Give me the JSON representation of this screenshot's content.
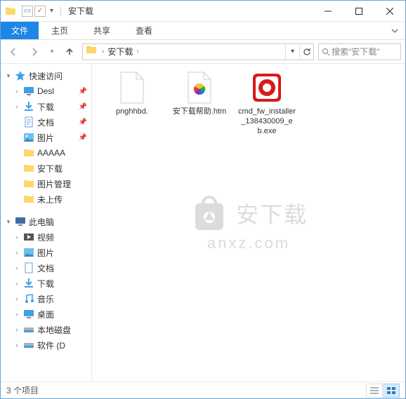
{
  "title": "安下载",
  "tabs": {
    "file": "文件",
    "home": "主页",
    "share": "共享",
    "view": "查看"
  },
  "address": {
    "crumb": "安下载"
  },
  "search": {
    "placeholder": "搜索\"安下载\""
  },
  "sidebar": {
    "quickAccess": "快速访问",
    "items": [
      {
        "label": "Desl",
        "pinned": true,
        "icon": "desktop"
      },
      {
        "label": "下载",
        "pinned": true,
        "icon": "downloads"
      },
      {
        "label": "文档",
        "pinned": true,
        "icon": "documents"
      },
      {
        "label": "图片",
        "pinned": true,
        "icon": "pictures"
      },
      {
        "label": "AAAAA",
        "pinned": false,
        "icon": "folder"
      },
      {
        "label": "安下载",
        "pinned": false,
        "icon": "folder"
      },
      {
        "label": "图片管理",
        "pinned": false,
        "icon": "folder"
      },
      {
        "label": "未上传",
        "pinned": false,
        "icon": "folder"
      }
    ],
    "thisPC": "此电脑",
    "pcItems": [
      {
        "label": "视频",
        "icon": "videos"
      },
      {
        "label": "图片",
        "icon": "pictures"
      },
      {
        "label": "文档",
        "icon": "documents"
      },
      {
        "label": "下载",
        "icon": "downloads"
      },
      {
        "label": "音乐",
        "icon": "music"
      },
      {
        "label": "桌面",
        "icon": "desktop-folder"
      },
      {
        "label": "本地磁盘",
        "icon": "drive"
      },
      {
        "label": "软件 (D",
        "icon": "drive"
      }
    ]
  },
  "files": [
    {
      "name": "pnghhbd.",
      "type": "blank"
    },
    {
      "name": "安下载帮助.htm",
      "type": "htm"
    },
    {
      "name": "cmd_fw_installer_138430009_eb.exe",
      "type": "exe-red"
    }
  ],
  "status": {
    "count": "3 个项目"
  },
  "watermark": {
    "cn": "安下载",
    "en": "anxz.com"
  }
}
